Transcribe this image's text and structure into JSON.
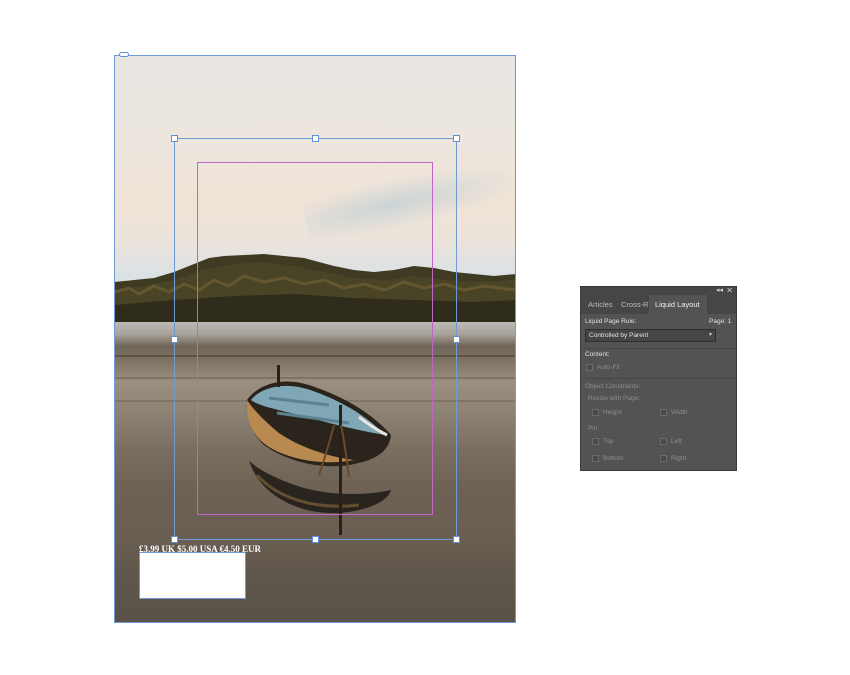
{
  "document": {
    "price_line": "£3.99 UK $5.00 USA €4.50 EUR"
  },
  "panel": {
    "tabs": [
      {
        "label": "Articles",
        "active": false
      },
      {
        "label": "Cross-R",
        "active": false
      },
      {
        "label": "Liquid Layout",
        "active": true
      }
    ],
    "collapse_glyph": "◂◂",
    "close_glyph": "✕",
    "liquid_page_rule_label": "Liquid Page Rule:",
    "page_label": "Page: 1",
    "rule_value": "Controlled by Parent",
    "content_label": "Content:",
    "auto_fit_label": "Auto-Fit",
    "object_constraints_label": "Object Constraints:",
    "resize_with_page_label": "Resize with Page:",
    "height_label": "Height",
    "width_label": "Width",
    "pin_label": "Pin:",
    "top_label": "Top",
    "left_label": "Left",
    "bottom_label": "Bottom",
    "right_label": "Right"
  },
  "colors": {
    "frame_blue": "#6e9bd6",
    "margin_magenta": "#c066c8",
    "panel_bg": "#535353"
  }
}
